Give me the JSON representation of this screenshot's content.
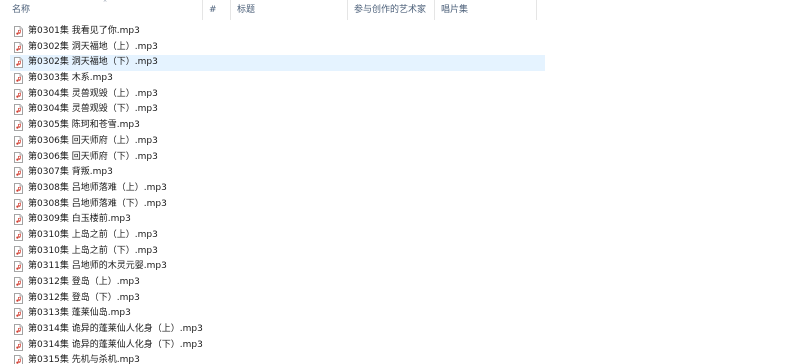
{
  "columns": {
    "name": "名称",
    "number": "#",
    "title": "标题",
    "artist": "参与创作的艺术家",
    "album": "唱片集"
  },
  "icon": "audio-file-icon",
  "selected_color": "#e5f3ff",
  "files": [
    {
      "name": "第0301集 我看见了你.mp3",
      "selected": false
    },
    {
      "name": "第0302集 洞天福地（上）.mp3",
      "selected": false
    },
    {
      "name": "第0302集 洞天福地（下）.mp3",
      "selected": true
    },
    {
      "name": "第0303集 木系.mp3",
      "selected": false
    },
    {
      "name": "第0304集 灵兽观毁（上）.mp3",
      "selected": false
    },
    {
      "name": "第0304集 灵兽观毁（下）.mp3",
      "selected": false
    },
    {
      "name": "第0305集 陈珂和苍雪.mp3",
      "selected": false
    },
    {
      "name": "第0306集 回天师府（上）.mp3",
      "selected": false
    },
    {
      "name": "第0306集 回天师府（下）.mp3",
      "selected": false
    },
    {
      "name": "第0307集 背叛.mp3",
      "selected": false
    },
    {
      "name": "第0308集 吕地师落难（上）.mp3",
      "selected": false
    },
    {
      "name": "第0308集 吕地师落难（下）.mp3",
      "selected": false
    },
    {
      "name": "第0309集 白玉楼前.mp3",
      "selected": false
    },
    {
      "name": "第0310集 上岛之前（上）.mp3",
      "selected": false
    },
    {
      "name": "第0310集 上岛之前（下）.mp3",
      "selected": false
    },
    {
      "name": "第0311集 吕地师的木灵元婴.mp3",
      "selected": false
    },
    {
      "name": "第0312集 登岛（上）.mp3",
      "selected": false
    },
    {
      "name": "第0312集 登岛（下）.mp3",
      "selected": false
    },
    {
      "name": "第0313集 蓬莱仙岛.mp3",
      "selected": false
    },
    {
      "name": "第0314集 诡异的蓬莱仙人化身（上）.mp3",
      "selected": false
    },
    {
      "name": "第0314集 诡异的蓬莱仙人化身（下）.mp3",
      "selected": false
    },
    {
      "name": "第0315集 先机与杀机.mp3",
      "selected": false
    }
  ]
}
